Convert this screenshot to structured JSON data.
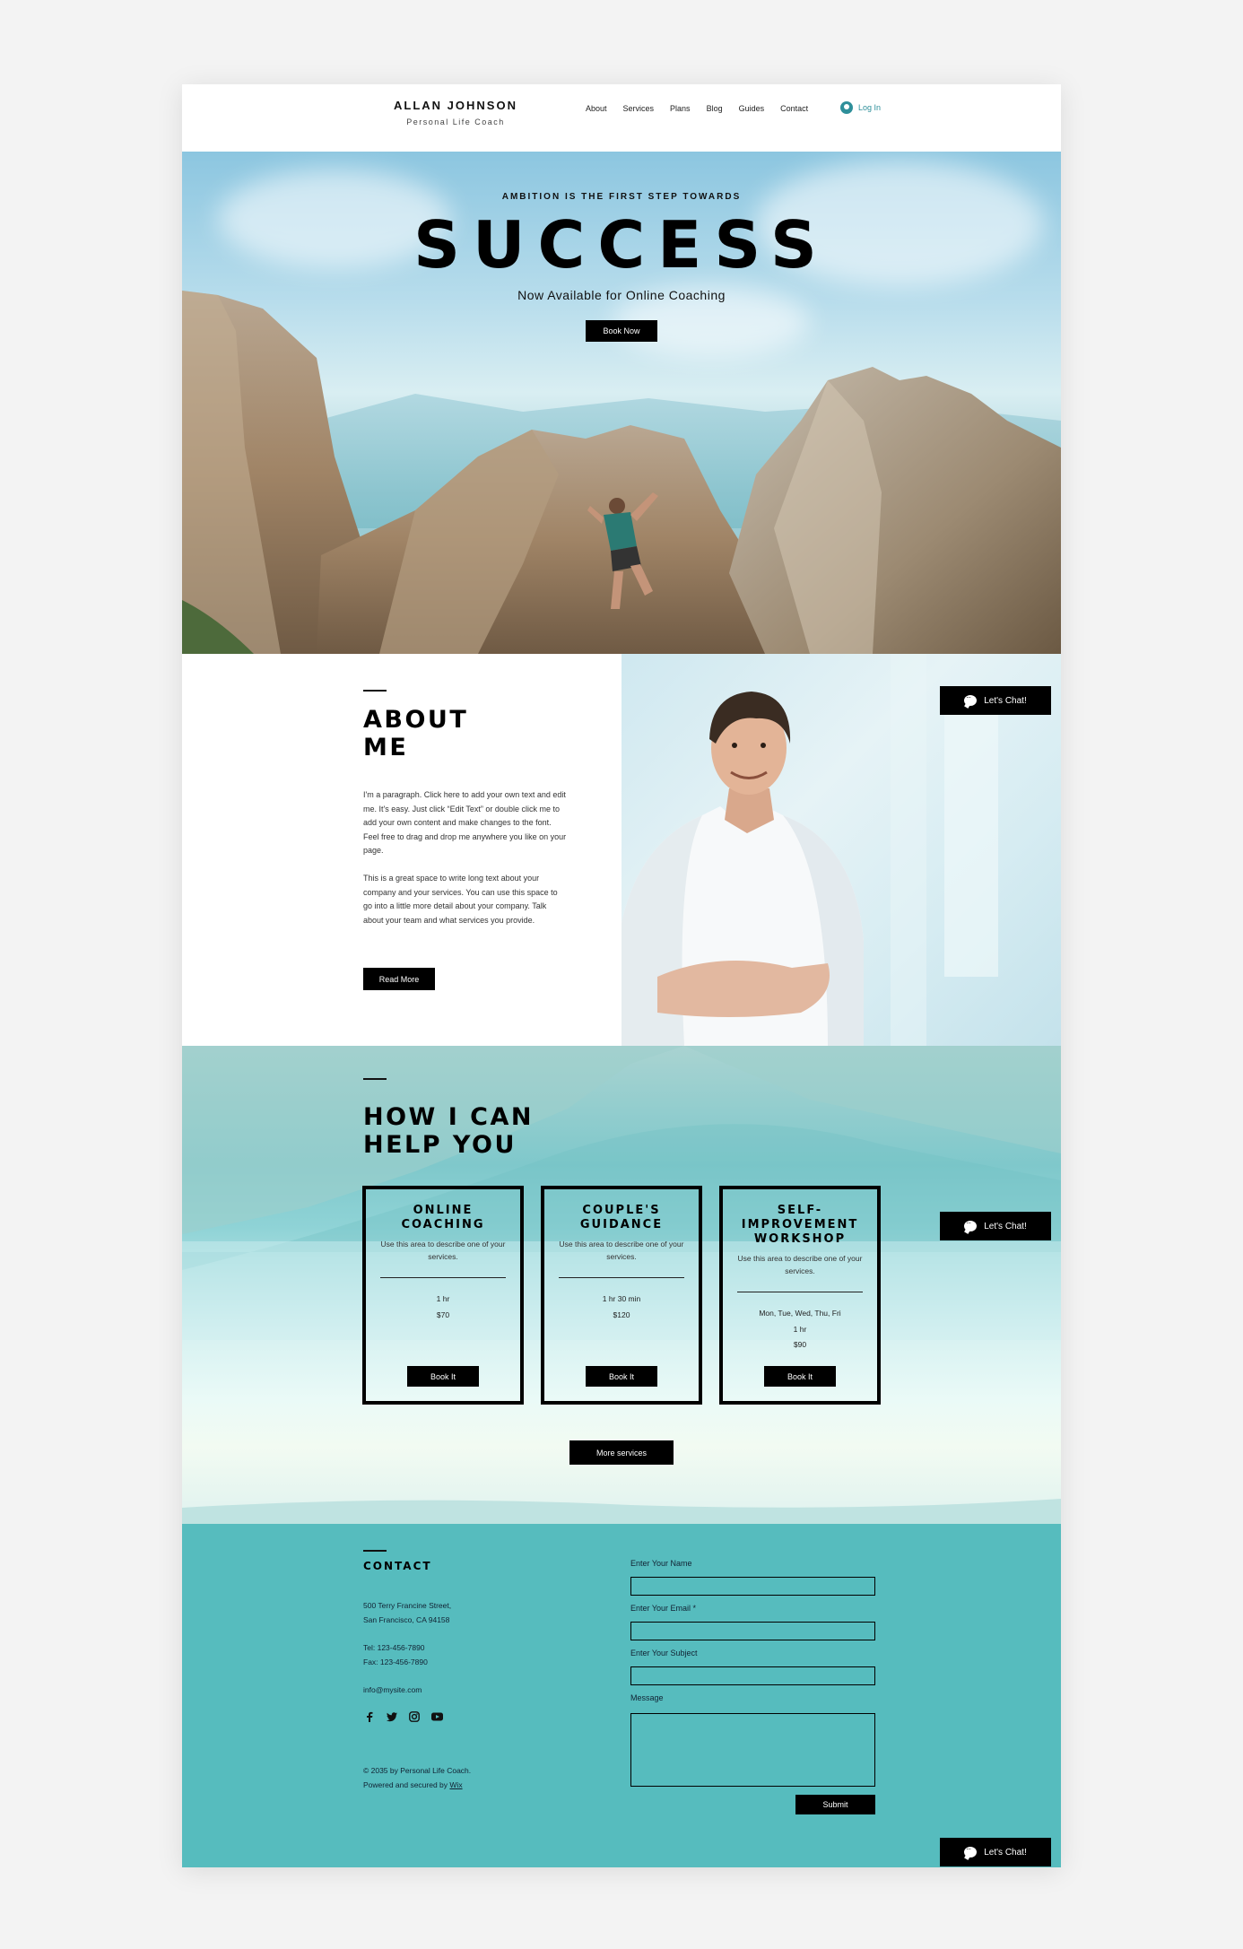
{
  "header": {
    "logo_name": "ALLAN JOHNSON",
    "logo_subtitle": "Personal Life Coach",
    "nav": [
      "About",
      "Services",
      "Plans",
      "Blog",
      "Guides",
      "Contact"
    ],
    "login_label": "Log In"
  },
  "hero": {
    "kicker": "AMBITION IS THE FIRST STEP TOWARDS",
    "title": "SUCCESS",
    "subtitle": "Now Available for Online Coaching",
    "button": "Book Now"
  },
  "about": {
    "title_line1": "ABOUT",
    "title_line2": "ME",
    "paragraph1": "I'm a paragraph. Click here to add your own text and edit me. It's easy. Just click “Edit Text” or double click me to add your own content and make changes to the font. Feel free to drag and drop me anywhere you like on your page.",
    "paragraph2": "This is a great space to write long text about your company and your services. You can use this space to go into a little more detail about your company. Talk about your team and what services you provide.",
    "button": "Read More"
  },
  "help": {
    "title_line1": "HOW I CAN",
    "title_line2": "HELP YOU",
    "services": [
      {
        "title": "ONLINE COACHING",
        "description": "Use this area to describe one of your services.",
        "duration": "1 hr",
        "price": "$70",
        "button": "Book It"
      },
      {
        "title": "COUPLE'S GUIDANCE",
        "description": "Use this area to describe one of your services.",
        "duration": "1 hr 30 min",
        "price": "$120",
        "button": "Book It"
      },
      {
        "title": "SELF-IMPROVEMENT WORKSHOP",
        "description": "Use this area to describe one of your services.",
        "days": "Mon, Tue, Wed, Thu, Fri",
        "duration": "1 hr",
        "price": "$90",
        "button": "Book It"
      }
    ],
    "more_button": "More services"
  },
  "contact": {
    "title": "CONTACT",
    "address_line1": "500 Terry Francine Street,",
    "address_line2": "San Francisco, CA 94158",
    "tel": "Tel: 123-456-7890",
    "fax": "Fax: 123-456-7890",
    "email": "info@mysite.com",
    "socials": [
      "facebook-icon",
      "twitter-icon",
      "instagram-icon",
      "youtube-icon"
    ],
    "copyright": "© 2035 by Personal Life Coach.",
    "powered_prefix": "Powered and secured by ",
    "powered_link": "Wix",
    "form": {
      "name_label": "Enter Your Name",
      "email_label": "Enter Your Email *",
      "subject_label": "Enter Your Subject",
      "message_label": "Message",
      "submit": "Submit"
    }
  },
  "chat_label": "Let's Chat!",
  "colors": {
    "accent_teal": "#56bcbe",
    "login_teal": "#2e8f9a",
    "button_black": "#000000"
  }
}
